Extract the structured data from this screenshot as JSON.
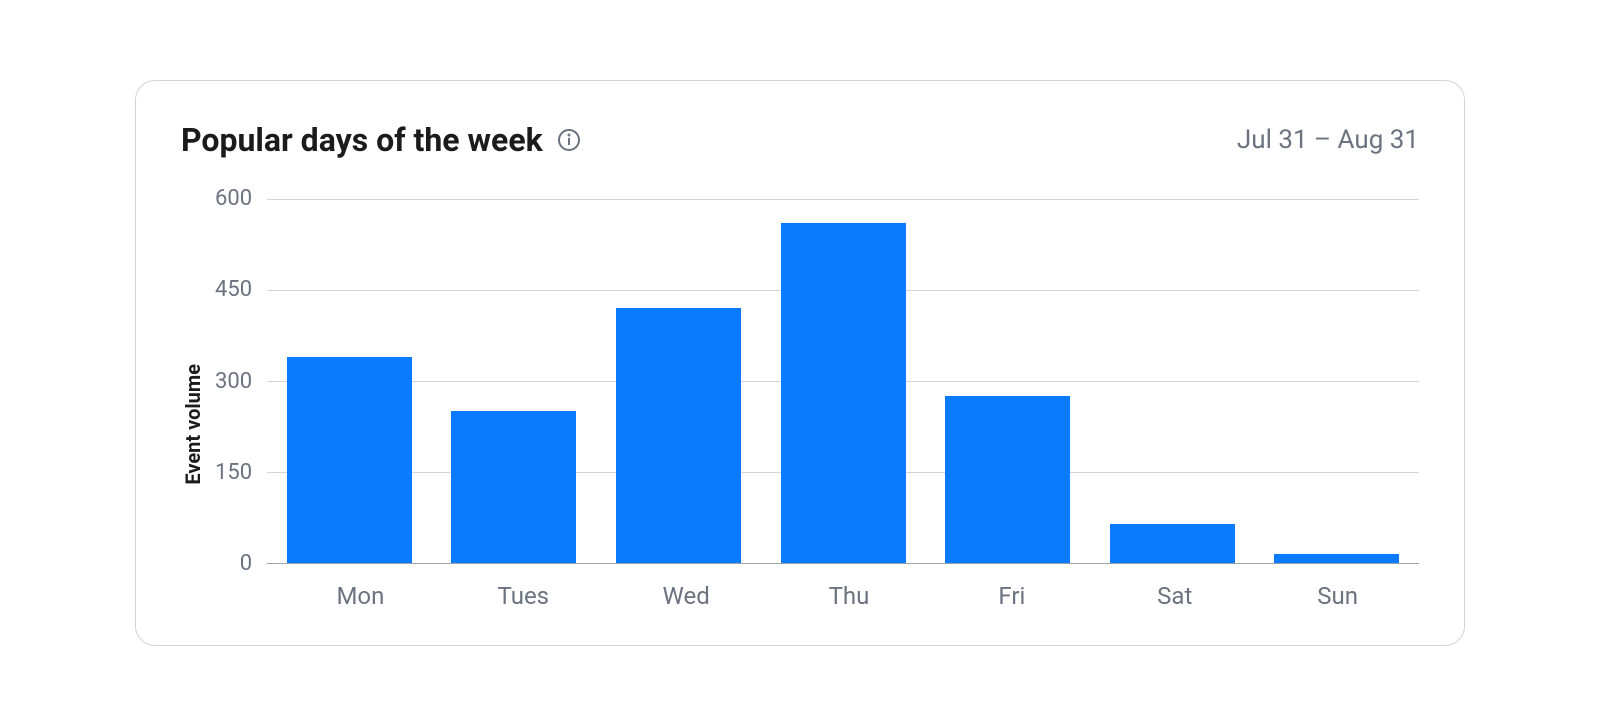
{
  "header": {
    "title": "Popular days of the week",
    "date_range": "Jul 31 – Aug 31"
  },
  "chart_data": {
    "type": "bar",
    "title": "Popular days of the week",
    "ylabel": "Event volume",
    "xlabel": "",
    "categories": [
      "Mon",
      "Tues",
      "Wed",
      "Thu",
      "Fri",
      "Sat",
      "Sun"
    ],
    "values": [
      340,
      250,
      420,
      560,
      275,
      65,
      15
    ],
    "y_ticks": [
      0,
      150,
      300,
      450,
      600
    ],
    "ylim": [
      0,
      600
    ],
    "bar_color": "#0a7aff"
  }
}
